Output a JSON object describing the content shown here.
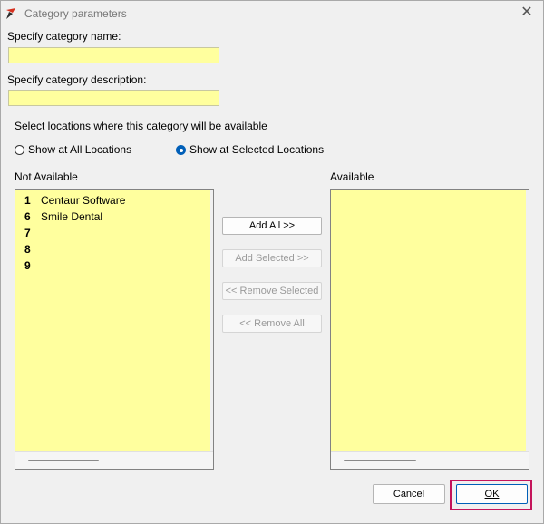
{
  "window": {
    "title": "Category parameters"
  },
  "form": {
    "name_label": "Specify category name:",
    "name_value": "",
    "description_label": "Specify category description:",
    "description_value": ""
  },
  "locations": {
    "prompt": "Select locations where this category will be available",
    "options": [
      {
        "label": "Show at All Locations",
        "selected": false
      },
      {
        "label": "Show at Selected Locations",
        "selected": true
      }
    ]
  },
  "not_available": {
    "header": "Not Available",
    "items": [
      {
        "num": "1",
        "name": "Centaur Software"
      },
      {
        "num": "6",
        "name": "Smile Dental"
      },
      {
        "num": "7",
        "name": ""
      },
      {
        "num": "8",
        "name": ""
      },
      {
        "num": "9",
        "name": ""
      }
    ]
  },
  "available": {
    "header": "Available",
    "items": []
  },
  "transfer_buttons": {
    "add_all": "Add All >>",
    "add_selected": "Add Selected >>",
    "remove_selected": "<< Remove Selected",
    "remove_all": "<< Remove All"
  },
  "footer": {
    "cancel": "Cancel",
    "ok": "OK"
  },
  "colors": {
    "field_bg": "#ffff9e",
    "highlight": "#c4145a",
    "accent": "#005fb8"
  }
}
